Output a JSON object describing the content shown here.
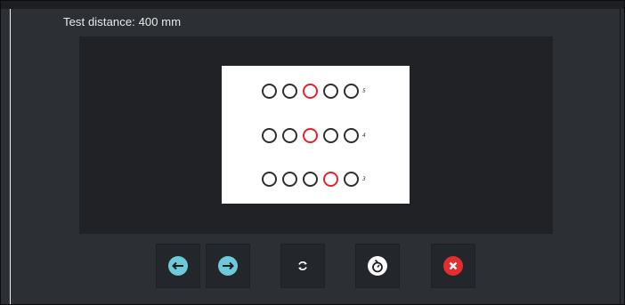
{
  "header": {
    "test_distance": "Test distance: 400 mm"
  },
  "chart_rows": [
    {
      "label": "5",
      "highlight_index": 2
    },
    {
      "label": "4",
      "highlight_index": 2
    },
    {
      "label": "3",
      "highlight_index": 3
    }
  ],
  "colors": {
    "ring": "#2f2f2f",
    "highlight": "#e3232a",
    "accent": "#6ec9d8",
    "close": "#e32d2f"
  },
  "toolbar": {
    "buttons": [
      {
        "name": "previous",
        "icon": "arrow-left-icon"
      },
      {
        "name": "next",
        "icon": "arrow-right-icon"
      },
      {
        "name": "refresh",
        "icon": "refresh-icon"
      },
      {
        "name": "timer",
        "icon": "stopwatch-icon"
      },
      {
        "name": "close",
        "icon": "close-icon"
      }
    ]
  }
}
